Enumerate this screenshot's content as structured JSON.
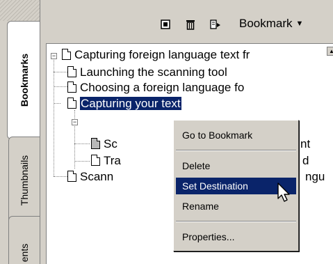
{
  "tabs": [
    {
      "label": "Bookmarks",
      "active": true
    },
    {
      "label": "Thumbnails",
      "active": false
    },
    {
      "label": "Comments",
      "active": false,
      "visible_text": "ents"
    }
  ],
  "toolbar": {
    "icons": [
      "new-bookmark-icon",
      "delete-icon",
      "expand-icon"
    ],
    "menu_label": "Bookmark",
    "menu_caret": "▼"
  },
  "tree": [
    {
      "label": "Capturing foreign language text  fr",
      "level": 0,
      "expander": "−"
    },
    {
      "label": "Launching the scanning tool",
      "level": 1
    },
    {
      "label": "Choosing a foreign language fo",
      "level": 1
    },
    {
      "label": "Capturing your text",
      "level": 1,
      "expander": "−",
      "selected": true
    },
    {
      "label": "Scanning text",
      "level": 2,
      "visible_prefix": "Sc",
      "visible_suffix": "nt"
    },
    {
      "label": "Translating the recorded",
      "level": 2,
      "visible_prefix": "Tra",
      "visible_suffix": "d"
    },
    {
      "label": "Scanning foreign language",
      "level": 1,
      "visible_prefix": "Scann",
      "visible_suffix": "ngu"
    }
  ],
  "context_menu": {
    "items": [
      {
        "label": "Go to Bookmark"
      },
      {
        "label": "Delete"
      },
      {
        "label": "Set Destination",
        "highlighted": true
      },
      {
        "label": "Rename"
      },
      {
        "label": "Properties..."
      }
    ]
  },
  "colors": {
    "chrome": "#d4d0c8",
    "selection": "#0a246a",
    "selection_text": "#ffffff"
  }
}
